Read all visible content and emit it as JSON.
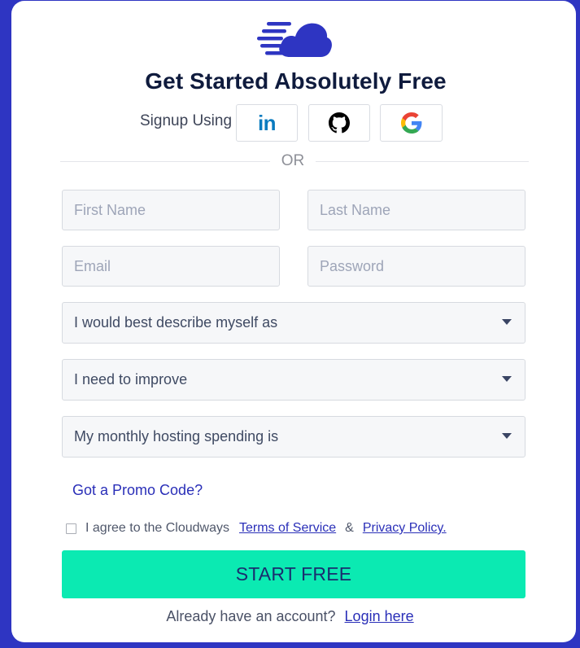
{
  "colors": {
    "background": "#2e35c2",
    "brand": "#2e35c2",
    "primary_button": "#0beab2",
    "link": "#2a2fb8",
    "title": "#0f1b3d"
  },
  "header": {
    "logo_icon": "cloudways-cloud-logo",
    "title": "Get Started Absolutely Free"
  },
  "social": {
    "label": "Signup Using",
    "buttons": [
      {
        "name": "linkedin",
        "icon": "linkedin-icon",
        "text": "in"
      },
      {
        "name": "github",
        "icon": "github-icon"
      },
      {
        "name": "google",
        "icon": "google-icon"
      }
    ]
  },
  "divider": {
    "text": "OR"
  },
  "form": {
    "first_name": {
      "placeholder": "First Name",
      "value": ""
    },
    "last_name": {
      "placeholder": "Last Name",
      "value": ""
    },
    "email": {
      "placeholder": "Email",
      "value": ""
    },
    "password": {
      "placeholder": "Password",
      "value": ""
    },
    "selects": [
      {
        "selected": "I would best describe myself as",
        "icon": "caret-down-icon"
      },
      {
        "selected": "I need to improve",
        "icon": "caret-down-icon"
      },
      {
        "selected": "My monthly hosting spending is",
        "icon": "caret-down-icon"
      }
    ],
    "promo_link": "Got a Promo Code?",
    "agree": {
      "checked": false,
      "text": "I agree to the Cloudways",
      "terms_link": "Terms of Service",
      "ampersand": "&",
      "privacy_link": "Privacy Policy."
    },
    "submit_label": "START FREE"
  },
  "footer": {
    "text": "Already have an account?",
    "login_link": "Login here"
  }
}
